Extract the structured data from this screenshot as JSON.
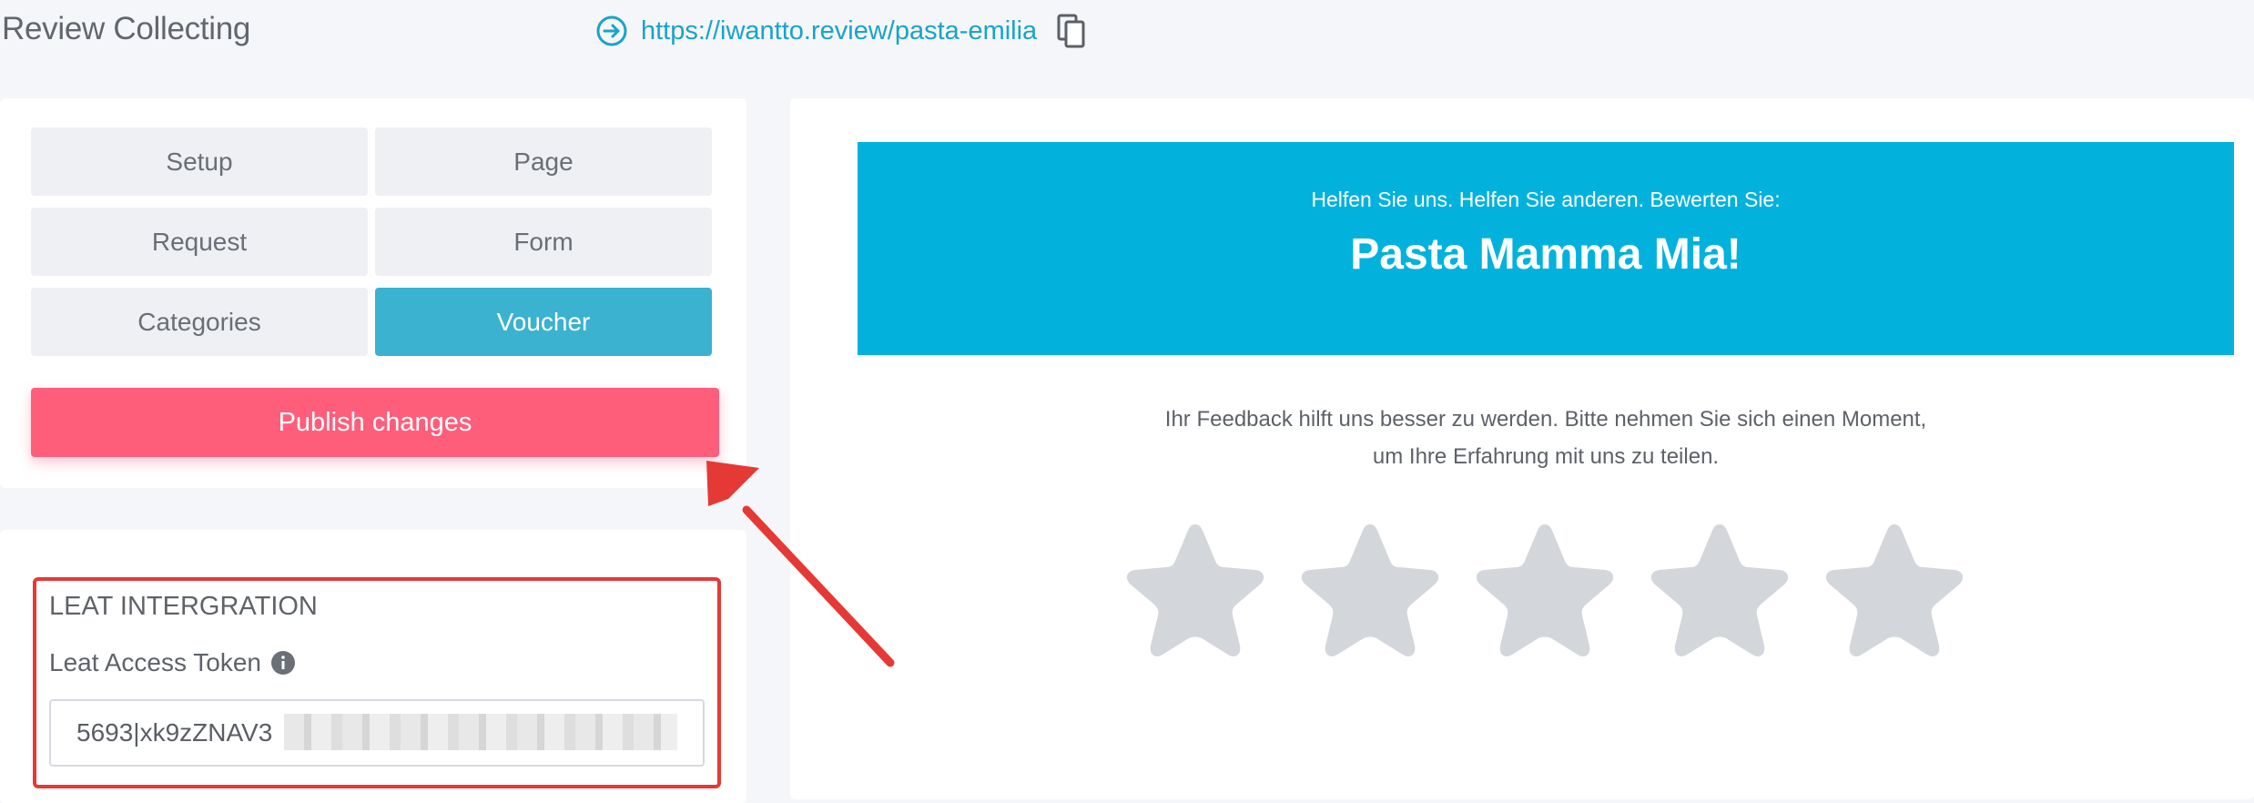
{
  "header": {
    "title": "Review Collecting",
    "url": "https://iwantto.review/pasta-emilia"
  },
  "tabs": [
    {
      "label": "Setup",
      "active": false
    },
    {
      "label": "Page",
      "active": false
    },
    {
      "label": "Request",
      "active": false
    },
    {
      "label": "Form",
      "active": false
    },
    {
      "label": "Categories",
      "active": false
    },
    {
      "label": "Voucher",
      "active": true
    }
  ],
  "publish": {
    "label": "Publish changes"
  },
  "leat": {
    "title": "LEAT INTERGRATION",
    "token_label": "Leat Access Token",
    "token_value": "5693|xk9zZNAV3"
  },
  "preview": {
    "subtitle": "Helfen Sie uns. Helfen Sie anderen. Bewerten Sie:",
    "title": "Pasta Mamma Mia!",
    "feedback": "Ihr Feedback hilft uns besser zu werden. Bitte nehmen Sie sich einen Moment, um Ihre Erfahrung mit uns zu teilen.",
    "star_count": 5,
    "rating": 0
  },
  "colors": {
    "accent": "#3ab2d0",
    "publish": "#ff5e7b",
    "hero": "#02b2dd",
    "annotation": "#e53935",
    "star": "#d3d6db"
  },
  "icons": {
    "url": "arrow-circle-right-icon",
    "copy": "copy-icon",
    "info": "info-icon"
  }
}
